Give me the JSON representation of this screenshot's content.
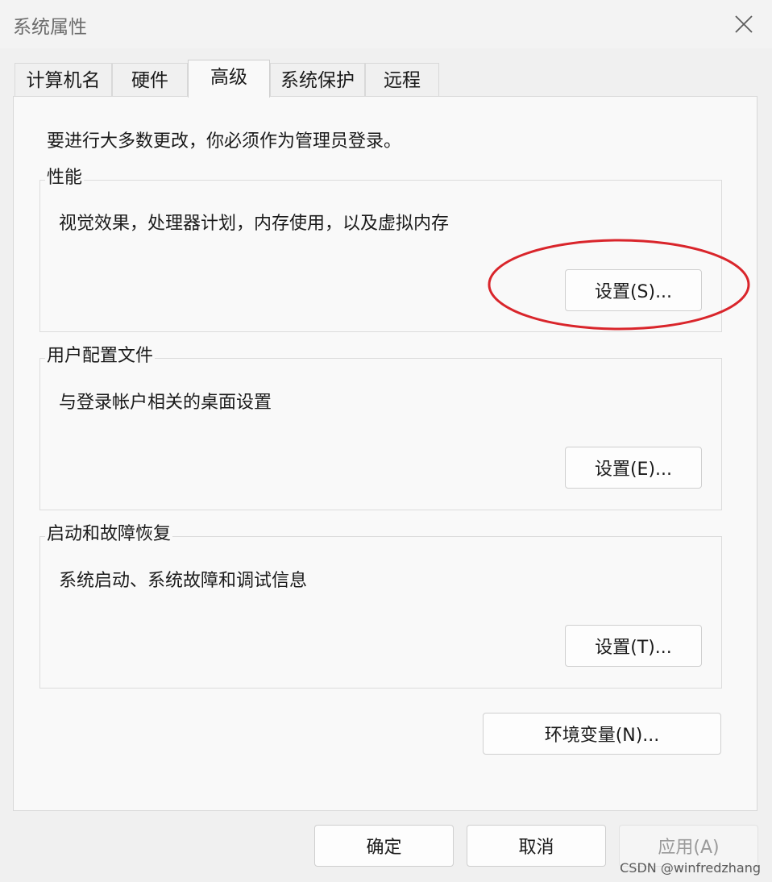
{
  "window": {
    "title": "系统属性",
    "close_icon": "close-icon"
  },
  "tabs": [
    {
      "label": "计算机名",
      "active": false
    },
    {
      "label": "硬件",
      "active": false
    },
    {
      "label": "高级",
      "active": true
    },
    {
      "label": "系统保护",
      "active": false
    },
    {
      "label": "远程",
      "active": false
    }
  ],
  "advanced": {
    "admin_note": "要进行大多数更改，你必须作为管理员登录。",
    "performance": {
      "title": "性能",
      "description": "视觉效果，处理器计划，内存使用，以及虚拟内存",
      "button": "设置(S)..."
    },
    "user_profiles": {
      "title": "用户配置文件",
      "description": "与登录帐户相关的桌面设置",
      "button": "设置(E)..."
    },
    "startup_recovery": {
      "title": "启动和故障恢复",
      "description": "系统启动、系统故障和调试信息",
      "button": "设置(T)..."
    },
    "env_button": "环境变量(N)..."
  },
  "footer": {
    "ok": "确定",
    "cancel": "取消",
    "apply": "应用(A)"
  },
  "annotation": {
    "color": "#d9252b",
    "highlights": "performance-settings-button"
  },
  "watermark": "CSDN @winfredzhang"
}
